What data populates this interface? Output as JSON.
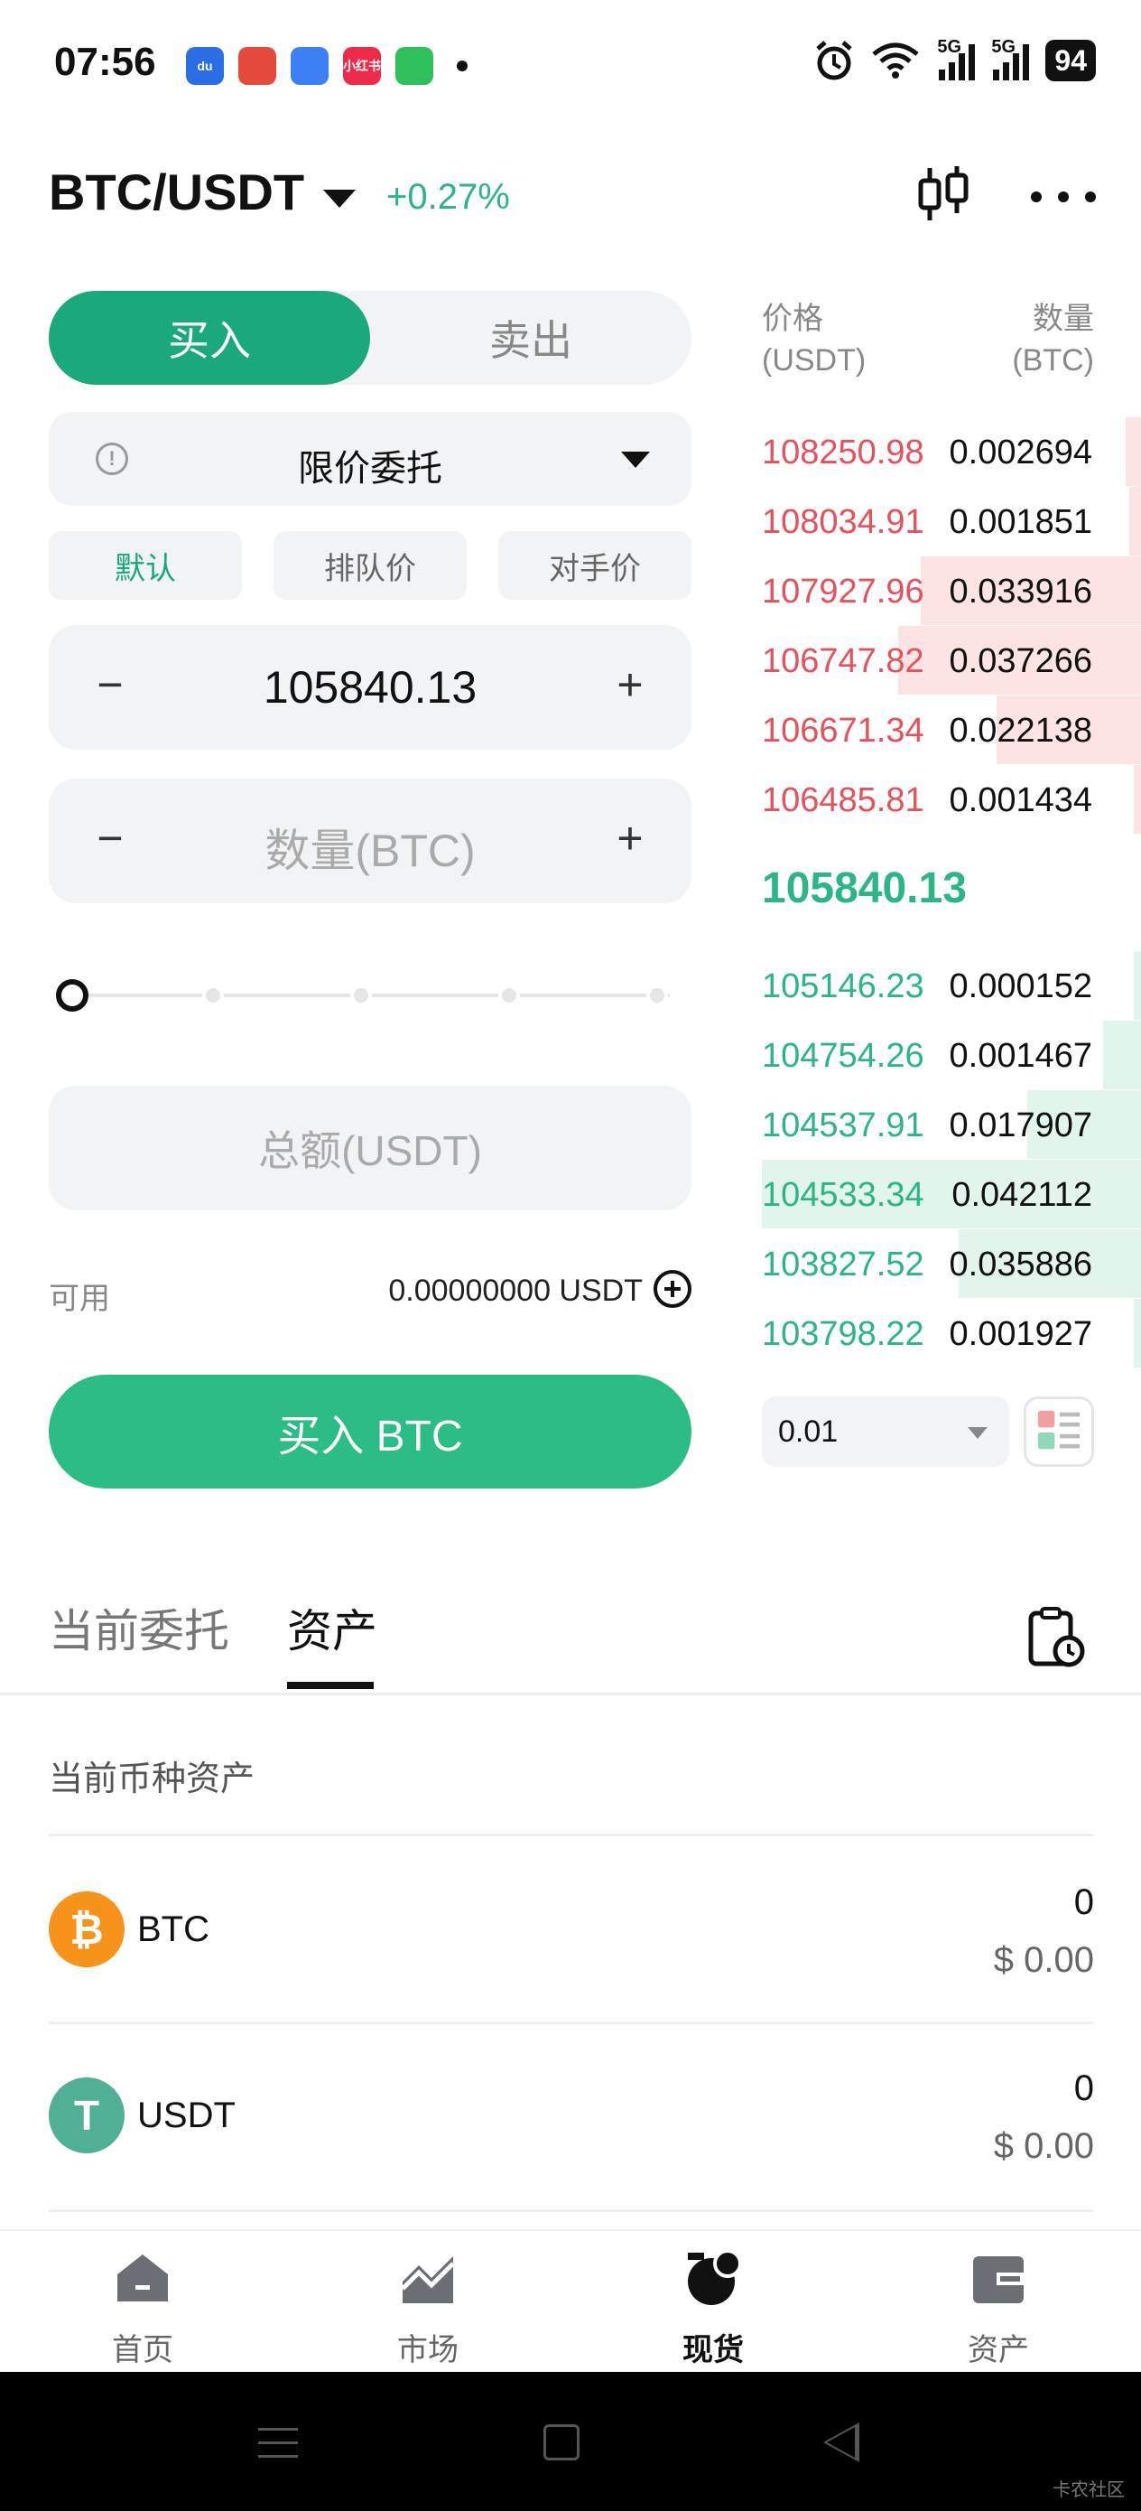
{
  "status_bar": {
    "time": "07:56",
    "apps": [
      {
        "name": "baidu-app-icon",
        "label": "du",
        "color": "#2b6de5"
      },
      {
        "name": "game-app-icon",
        "label": "",
        "color": "#e64a3c"
      },
      {
        "name": "browser-app-icon",
        "label": "",
        "color": "#3d7ff5"
      },
      {
        "name": "xiaohongshu-app-icon",
        "label": "小红书",
        "color": "#ee2a4a"
      },
      {
        "name": "security-app-icon",
        "label": "",
        "color": "#2fbf5b"
      }
    ],
    "signal_label": "5G",
    "battery": "94"
  },
  "header": {
    "pair": "BTC/USDT",
    "change": "+0.27%"
  },
  "trade_form": {
    "buy_tab": "买入",
    "sell_tab": "卖出",
    "order_type": "限价委托",
    "price_buttons": [
      "默认",
      "排队价",
      "对手价"
    ],
    "price_value": "105840.13",
    "minus": "−",
    "plus": "+",
    "qty_placeholder": "数量(BTC)",
    "slider_percent": 0,
    "total_placeholder": "总额(USDT)",
    "available_label": "可用",
    "available_value": "0.00000000 USDT",
    "submit_label": "买入 BTC"
  },
  "orderbook": {
    "price_header": "价格",
    "price_unit": "(USDT)",
    "qty_header": "数量",
    "qty_unit": "(BTC)",
    "asks": [
      {
        "price": "108250.98",
        "qty": "0.002694",
        "depth": 0.04
      },
      {
        "price": "108034.91",
        "qty": "0.001851",
        "depth": 0.03
      },
      {
        "price": "107927.96",
        "qty": "0.033916",
        "depth": 0.58
      },
      {
        "price": "106747.82",
        "qty": "0.037266",
        "depth": 0.64
      },
      {
        "price": "106671.34",
        "qty": "0.022138",
        "depth": 0.38
      },
      {
        "price": "106485.81",
        "qty": "0.001434",
        "depth": 0.02
      }
    ],
    "mid_price": "105840.13",
    "bids": [
      {
        "price": "105146.23",
        "qty": "0.000152",
        "depth": 0.01
      },
      {
        "price": "104754.26",
        "qty": "0.001467",
        "depth": 0.1
      },
      {
        "price": "104537.91",
        "qty": "0.017907",
        "depth": 0.3
      },
      {
        "price": "104533.34",
        "qty": "0.042112",
        "depth": 1.0
      },
      {
        "price": "103827.52",
        "qty": "0.035886",
        "depth": 0.48
      },
      {
        "price": "103798.22",
        "qty": "0.001927",
        "depth": 0.02
      }
    ],
    "precision": "0.01"
  },
  "tabs": {
    "current_orders": "当前委托",
    "assets": "资产"
  },
  "assets": {
    "title": "当前币种资产",
    "coins": [
      {
        "symbol": "BTC",
        "icon_char": "₿",
        "color": "#f7931a",
        "amount": "0",
        "usd": "$ 0.00"
      },
      {
        "symbol": "USDT",
        "icon_char": "T",
        "color": "#50af95",
        "amount": "0",
        "usd": "$ 0.00"
      }
    ]
  },
  "bottom_nav": {
    "items": [
      {
        "label": "首页",
        "icon": "home-icon"
      },
      {
        "label": "市场",
        "icon": "market-chart-icon"
      },
      {
        "label": "现货",
        "icon": "spot-icon"
      },
      {
        "label": "资产",
        "icon": "wallet-icon"
      }
    ],
    "active": 2
  },
  "watermark": "卡农社区",
  "colors": {
    "green": "#2bb683",
    "red": "#e5515c",
    "buy_button": "#2bbd85"
  }
}
